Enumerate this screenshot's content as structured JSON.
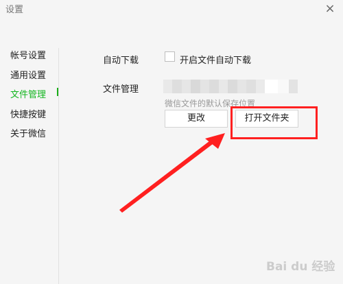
{
  "window": {
    "title": "设置",
    "close_glyph": "×"
  },
  "sidebar": {
    "items": [
      {
        "label": "帐号设置",
        "active": false
      },
      {
        "label": "通用设置",
        "active": false
      },
      {
        "label": "文件管理",
        "active": true
      },
      {
        "label": "快捷按键",
        "active": false
      },
      {
        "label": "关于微信",
        "active": false
      }
    ]
  },
  "file_settings": {
    "auto_download_label": "自动下载",
    "auto_download_checkbox_label": "开启文件自动下载",
    "auto_download_checked": false,
    "file_management_label": "文件管理",
    "path_hint": "微信文件的默认保存位置",
    "change_button": "更改",
    "open_folder_button": "打开文件夹"
  },
  "annotation": {
    "highlight_color": "#ff2020",
    "arrow_color": "#ff2020"
  },
  "watermark": "Bai du 经验",
  "colors": {
    "accent": "#1aad19",
    "background": "#f5f5f5"
  }
}
